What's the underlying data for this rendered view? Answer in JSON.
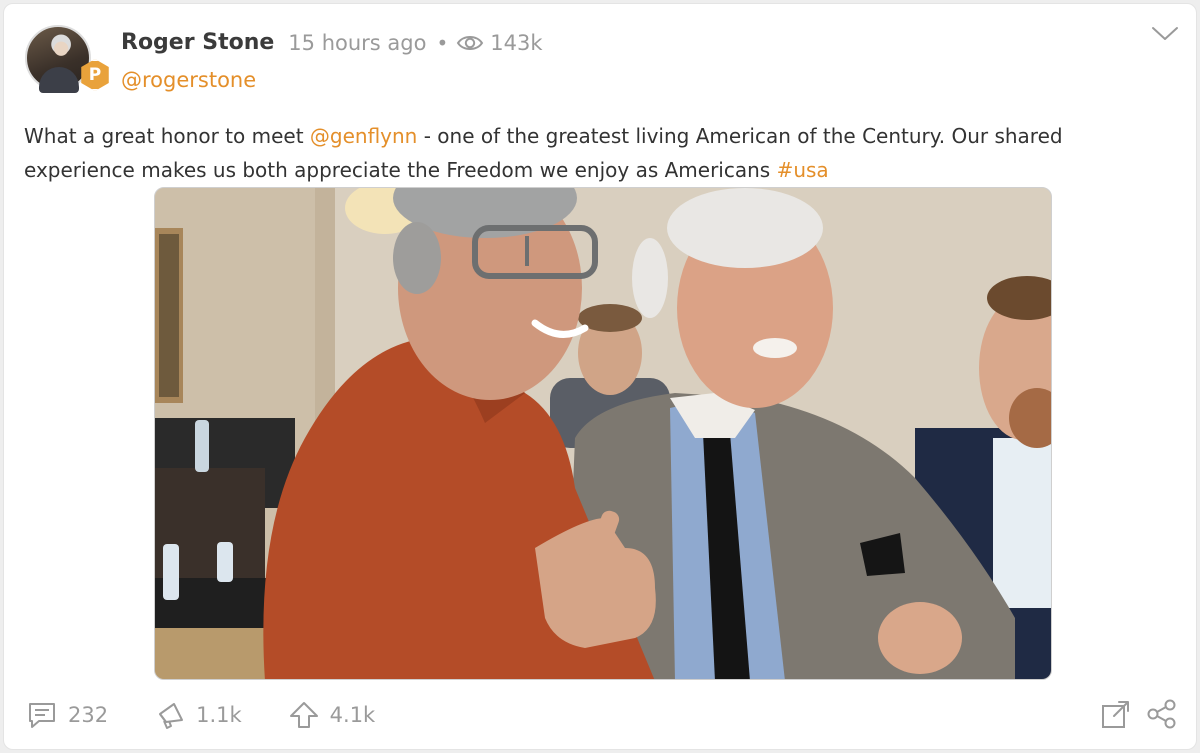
{
  "post": {
    "author": {
      "display_name": "Roger Stone",
      "handle": "@rogerstone",
      "badge_icon": "parler-badge-icon",
      "badge_color": "#e9a23b"
    },
    "timestamp": "15 hours ago",
    "separator": "•",
    "views": "143k",
    "text": {
      "part1": "What a great honor to meet ",
      "mention": "@genflynn",
      "part2": " - one of the greatest living American of the Century. Our shared experience makes us both appreciate the Freedom we enjoy as Americans ",
      "hashtag": "#usa"
    },
    "accent_color": "#e48f2a"
  },
  "actions": {
    "comments": "232",
    "echoes": "1.1k",
    "upvotes": "4.1k"
  }
}
